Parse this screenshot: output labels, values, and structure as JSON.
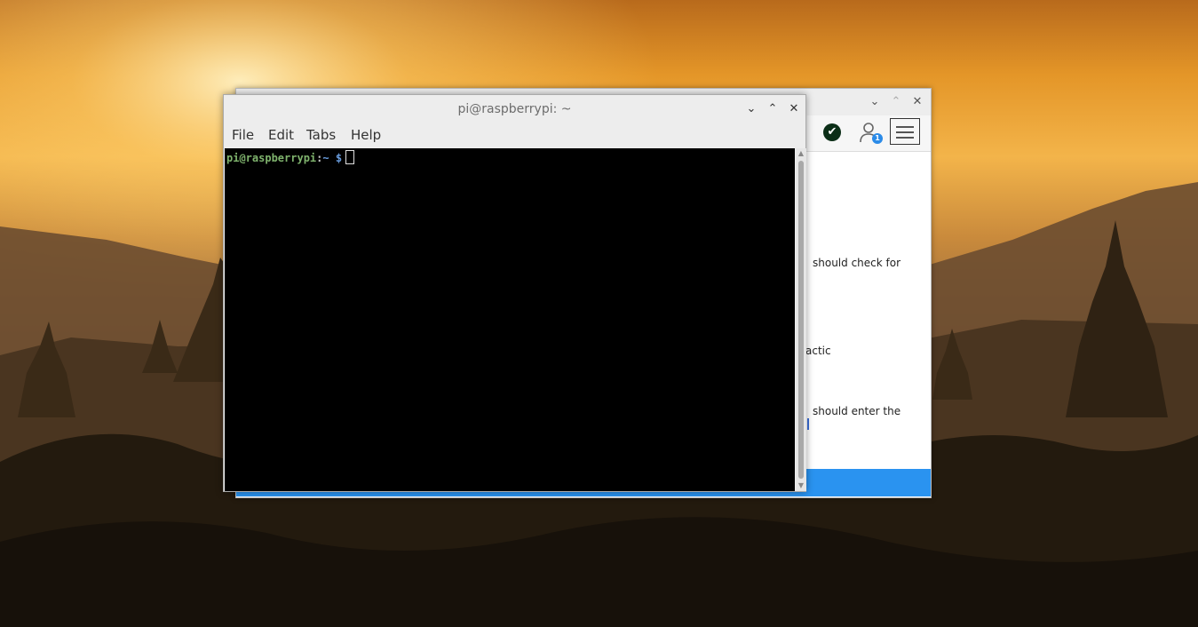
{
  "desktop": {
    "wallpaper": "sunset-pagodas"
  },
  "background_window": {
    "controls": [
      "⌄",
      "⌃",
      "✕"
    ],
    "toolbar": {
      "check_icon": "✔",
      "user_icon": "user-icon",
      "notification_count": "1",
      "menu_icon": "hamburger-menu-icon"
    },
    "visible_text": [
      "should check for",
      "actic",
      "should enter the"
    ],
    "accent_color": "#2a93f0"
  },
  "terminal": {
    "title": "pi@raspberrypi: ~",
    "controls": [
      "⌄",
      "⌃",
      "✕"
    ],
    "menu": [
      "File",
      "Edit",
      "Tabs",
      "Help"
    ],
    "prompt": {
      "user": "pi@raspberrypi",
      "colon": ":",
      "path": "~",
      "dollar": " $"
    },
    "colors": {
      "user": "#7fb36d",
      "path": "#6a9ee0",
      "background": "#000000"
    }
  }
}
